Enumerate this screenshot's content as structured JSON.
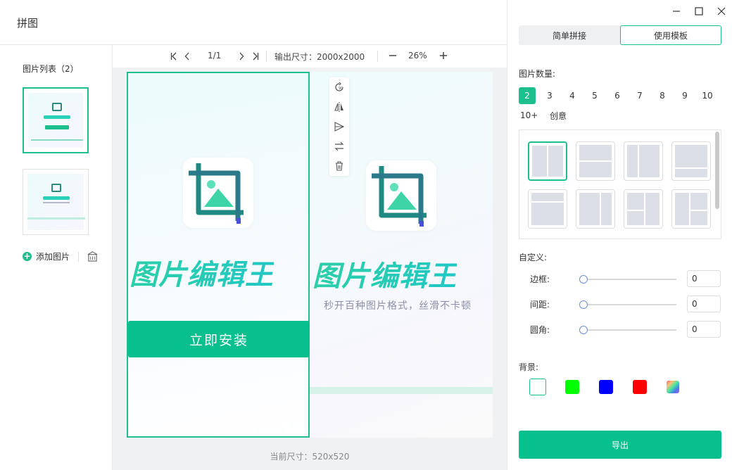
{
  "app": {
    "title": "拼图"
  },
  "left_panel": {
    "list_title": "图片列表（2）",
    "add_image_label": "添加图片"
  },
  "toolbar": {
    "page_indicator": "1/1",
    "output_size": "输出尺寸：2000x2000",
    "zoom": "26%"
  },
  "canvas": {
    "brand_text": "图片编辑王",
    "install_label": "立即安装",
    "slogan": "秒开百种图片格式，丝滑不卡顿",
    "current_size": "当前尺寸：520x520"
  },
  "right_panel": {
    "tabs": [
      "简单拼接",
      "使用模板"
    ],
    "active_tab": "使用模板",
    "count_label": "图片数量:",
    "counts": [
      "2",
      "3",
      "4",
      "5",
      "6",
      "7",
      "8",
      "9",
      "10"
    ],
    "counts_row2": [
      "10+",
      "创意"
    ],
    "selected_count": "2",
    "custom_label": "自定义:",
    "sliders": [
      {
        "label": "边框:",
        "value": "0"
      },
      {
        "label": "间距:",
        "value": "0"
      },
      {
        "label": "圆角:",
        "value": "0"
      }
    ],
    "background_label": "背景:",
    "background_colors": [
      "#ffffff",
      "#00ff00",
      "#0000ff",
      "#ff0000",
      "gradient"
    ],
    "export_label": "导出"
  },
  "colors": {
    "accent": "#1cbf8d"
  }
}
